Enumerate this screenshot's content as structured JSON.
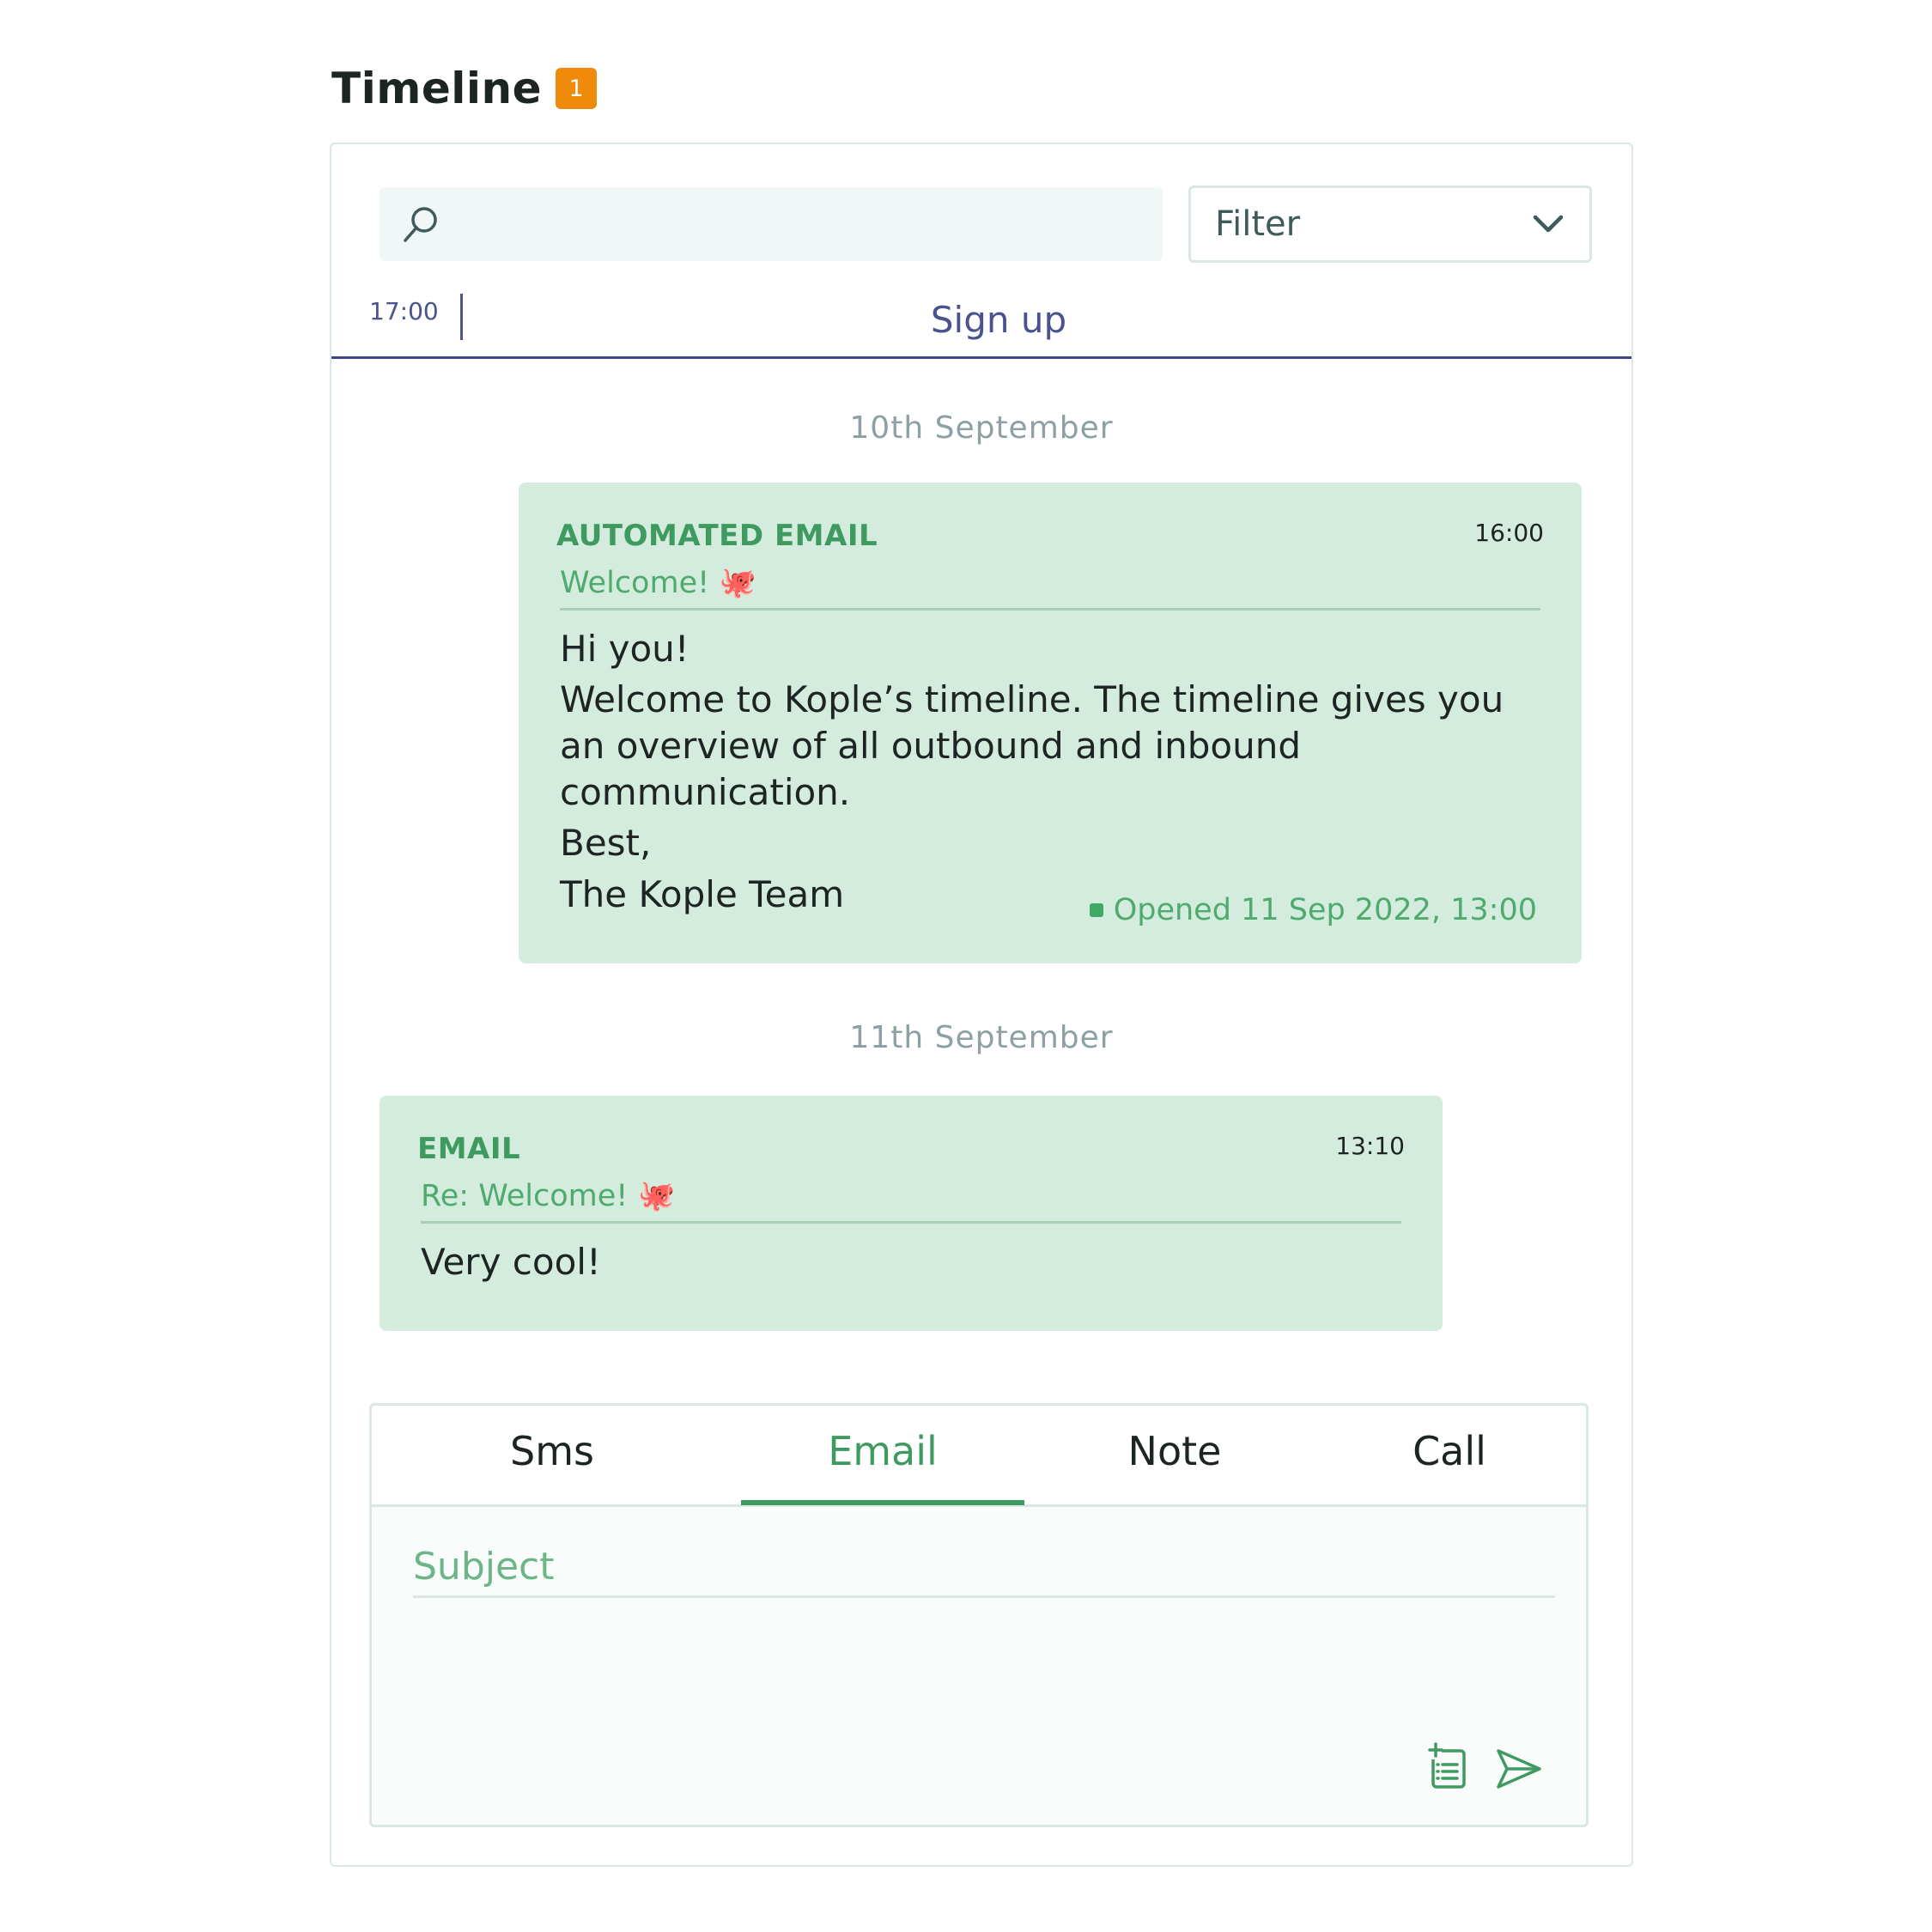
{
  "header": {
    "title": "Timeline",
    "badge_count": "1"
  },
  "search": {
    "placeholder": "",
    "value": ""
  },
  "filter": {
    "label": "Filter"
  },
  "event_bar": {
    "time": "17:00",
    "label": "Sign up"
  },
  "timeline": [
    {
      "date": "10th September",
      "message": {
        "type": "AUTOMATED EMAIL",
        "time": "16:00",
        "subject": "Welcome! 🐙",
        "body": [
          "Hi you!",
          "Welcome to Kople’s timeline. The timeline gives you an overview of all outbound and inbound communication.",
          "Best,",
          "The Kople Team"
        ],
        "status": "Opened 11 Sep 2022, 13:00"
      }
    },
    {
      "date": "11th September",
      "message": {
        "type": "EMAIL",
        "time": "13:10",
        "subject": "Re: Welcome! 🐙",
        "body": [
          "Very cool!"
        ]
      }
    }
  ],
  "composer": {
    "tabs": [
      "Sms",
      "Email",
      "Note",
      "Call"
    ],
    "active_tab": "Email",
    "subject_placeholder": "Subject"
  },
  "colors": {
    "accent_green": "#3f9a60",
    "message_bg": "#d4ecdd",
    "event_indigo": "#4a5390",
    "badge_orange": "#f08a0a"
  },
  "icons": [
    "search-icon",
    "chevron-down-icon",
    "add-note-icon",
    "send-icon"
  ]
}
